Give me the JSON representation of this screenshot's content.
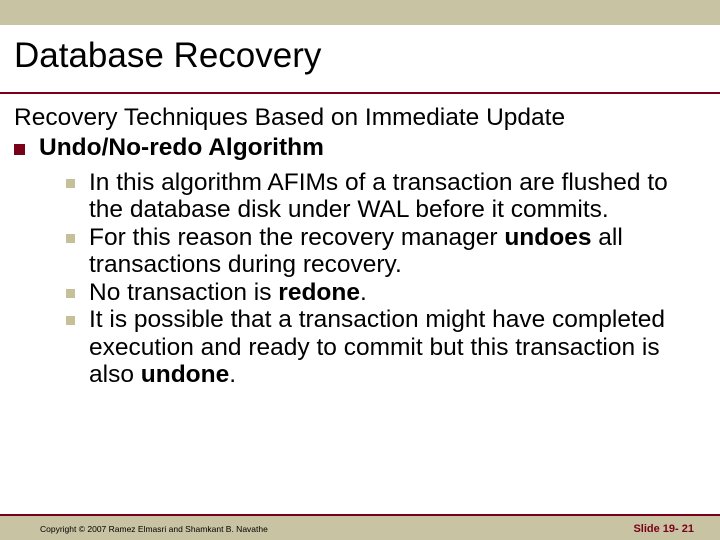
{
  "title": "Database Recovery",
  "subtitle": "Recovery Techniques Based on Immediate Update",
  "lvl1_item": "Undo/No-redo Algorithm",
  "sub_items": [
    {
      "pre": "In this algorithm AFIMs of a transaction are flushed to the database disk under WAL before it commits."
    },
    {
      "pre": "For this reason the recovery manager ",
      "bold1": "undoes",
      "post1": " all transactions during recovery."
    },
    {
      "pre": "No transaction is ",
      "bold1": "redone",
      "post1": "."
    },
    {
      "pre": "It is possible that a transaction might have completed execution and ready to commit but this transaction is also ",
      "bold1": "undone",
      "post1": "."
    }
  ],
  "copyright": "Copyright © 2007 Ramez Elmasri and Shamkant B. Navathe",
  "slide_label_prefix": "Slide 19- ",
  "slide_number": "21"
}
